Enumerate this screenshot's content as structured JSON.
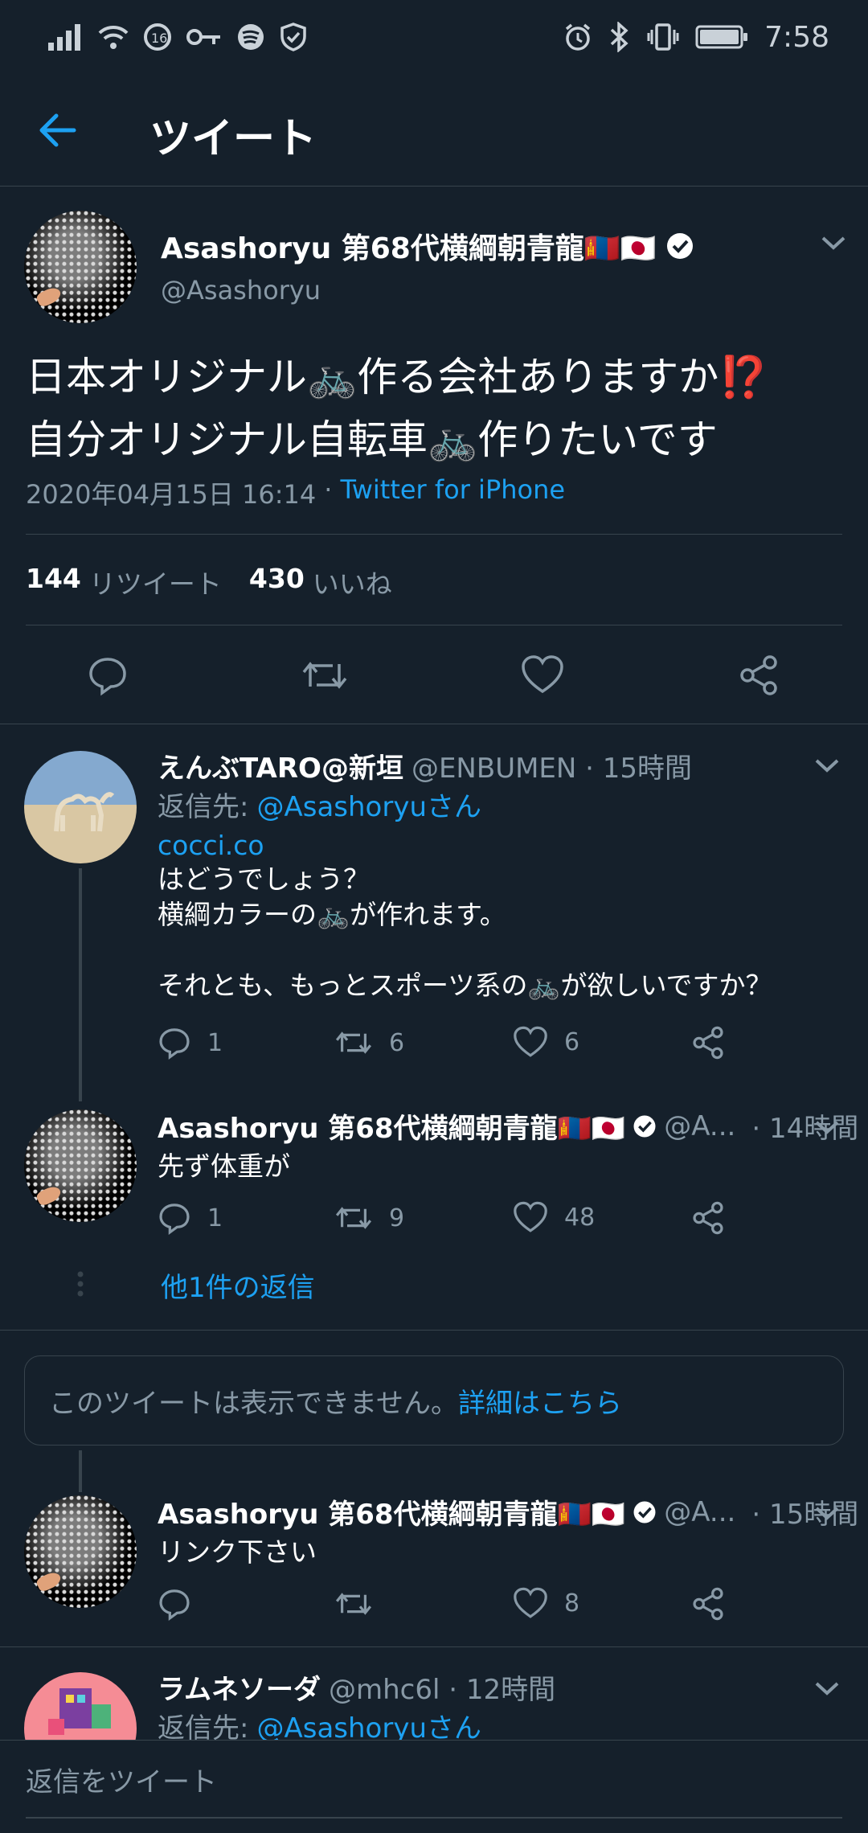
{
  "status_bar": {
    "time": "7:58"
  },
  "header": {
    "title": "ツイート"
  },
  "main_tweet": {
    "name": "Asashoryu 第68代横綱朝青龍🇲🇳🇯🇵",
    "handle": "@Asashoryu",
    "text_line1": "日本オリジナル🚲作る会社ありますか⁉️",
    "text_line2": "自分オリジナル自転車🚲作りたいです",
    "datetime": "2020年04月15日 16:14",
    "separator": "·",
    "source": "Twitter for iPhone",
    "retweets_count": "144",
    "retweets_label": "リツイート",
    "likes_count": "430",
    "likes_label": "いいね"
  },
  "replies": [
    {
      "name": "えんぶTARO@新垣",
      "handle_time": "@ENBUMEN · 15時間",
      "reply_to_label": "返信先:",
      "reply_to": "@Asashoryuさん",
      "link": "cocci.co",
      "text_lines": [
        "はどうでしょう？",
        "横綱カラーの🚲が作れます。",
        "",
        "それとも、もっとスポーツ系の🚲が欲しいですか？"
      ],
      "reply_count": "1",
      "retweet_count": "6",
      "like_count": "6"
    },
    {
      "name": "Asashoryu 第68代横綱朝青龍🇲🇳🇯🇵",
      "handle": "@A...",
      "time": "· 14時間",
      "text": "先ず体重が",
      "reply_count": "1",
      "retweet_count": "9",
      "like_count": "48",
      "more_replies": "他1件の返信"
    },
    {
      "unavailable_text": "このツイートは表示できません。",
      "unavailable_link": "詳細はこちら"
    },
    {
      "name": "Asashoryu 第68代横綱朝青龍🇲🇳🇯🇵",
      "handle": "@A...",
      "time": "· 15時間",
      "text": "リンク下さい",
      "like_count": "8"
    },
    {
      "name": "ラムネソーダ",
      "handle_time": "@mhc6l · 12時間",
      "reply_to_label": "返信先:",
      "reply_to": "@Asashoryuさん"
    }
  ],
  "reply_bar": {
    "placeholder": "返信をツイート"
  },
  "icons": [
    "back-arrow-icon",
    "caret-down-icon",
    "reply-icon",
    "retweet-icon",
    "like-icon",
    "share-icon",
    "verified-icon"
  ],
  "colors": {
    "background": "#15202b",
    "accent": "#1da1f2",
    "muted": "#8899a6",
    "divider": "#38444d"
  }
}
